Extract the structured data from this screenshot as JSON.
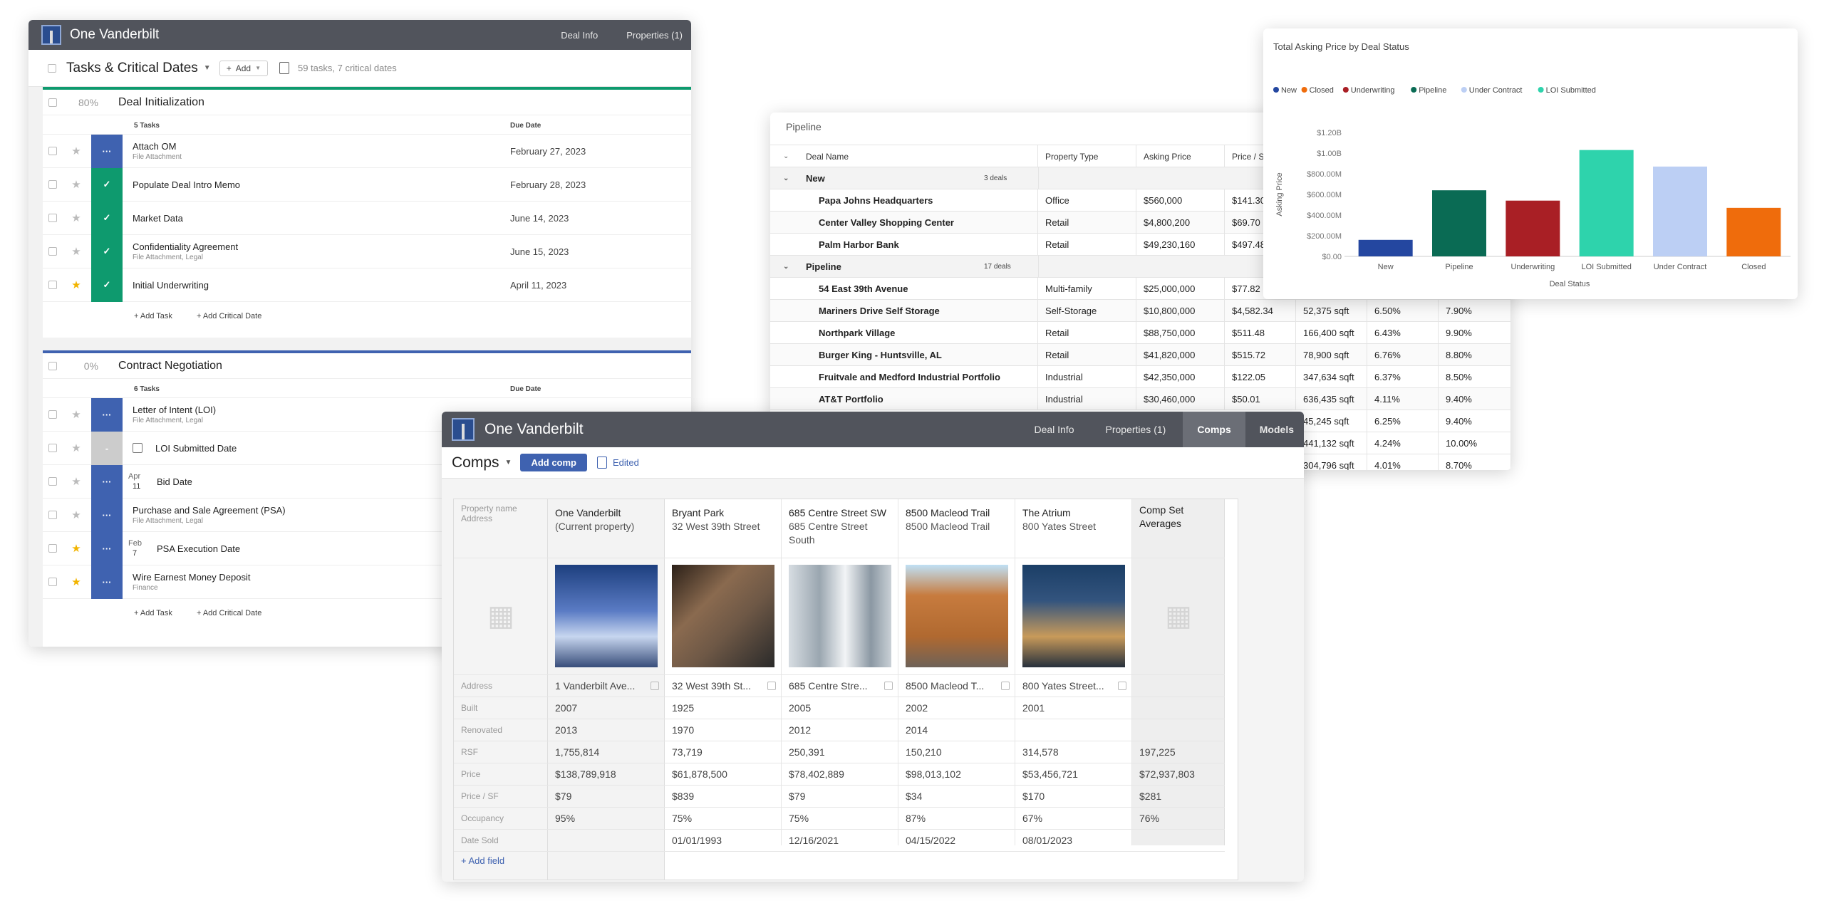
{
  "tasks_window": {
    "app_title": "One Vanderbilt",
    "nav": [
      "Deal Info",
      "Properties (1)"
    ],
    "title": "Tasks & Critical Dates",
    "add_label": "Add",
    "summary": "59 tasks, 7 critical dates",
    "due_header": "Due Date",
    "add_task": "Add Task",
    "add_critical": "Add Critical Date",
    "sections": [
      {
        "percent": "80%",
        "progress": 0.8,
        "name": "Deal Initialization",
        "count": "5 Tasks",
        "color": "#0e9a6e",
        "tasks": [
          {
            "name": "Attach OM",
            "sub": "File Attachment",
            "due": "February 27, 2023",
            "status": "blue",
            "star": false,
            "glyph": "···"
          },
          {
            "name": "Populate Deal Intro Memo",
            "sub": "",
            "due": "February 28, 2023",
            "status": "green",
            "star": false,
            "glyph": "✓"
          },
          {
            "name": "Market Data",
            "sub": "",
            "due": "June 14, 2023",
            "status": "green",
            "star": false,
            "glyph": "✓"
          },
          {
            "name": "Confidentiality Agreement",
            "sub": "File Attachment, Legal",
            "due": "June 15, 2023",
            "status": "green",
            "star": false,
            "glyph": "✓"
          },
          {
            "name": "Initial Underwriting",
            "sub": "",
            "due": "April 11, 2023",
            "status": "green",
            "star": true,
            "glyph": "✓"
          }
        ]
      },
      {
        "percent": "0%",
        "progress": 0,
        "name": "Contract Negotiation",
        "count": "6 Tasks",
        "color": "#3f62b0",
        "tasks": [
          {
            "name": "Letter of Intent (LOI)",
            "sub": "File Attachment, Legal",
            "status": "blue",
            "star": false,
            "glyph": "···"
          },
          {
            "name": "LOI Submitted Date",
            "sub": "",
            "status": "gray",
            "star": false,
            "glyph": "-",
            "date_icon": "calendar"
          },
          {
            "name": "Bid Date",
            "sub": "",
            "status": "blue",
            "star": false,
            "glyph": "···",
            "date_mon": "Apr",
            "date_day": "11"
          },
          {
            "name": "Purchase and Sale Agreement (PSA)",
            "sub": "File Attachment, Legal",
            "status": "blue",
            "star": false,
            "glyph": "···"
          },
          {
            "name": "PSA Execution Date",
            "sub": "",
            "status": "blue",
            "star": true,
            "glyph": "···",
            "date_mon": "Feb",
            "date_day": "7"
          },
          {
            "name": "Wire Earnest Money Deposit",
            "sub": "Finance",
            "status": "blue",
            "star": true,
            "glyph": "···"
          }
        ]
      }
    ]
  },
  "pipeline_window": {
    "title": "Pipeline",
    "headers": [
      "Deal Name",
      "Property Type",
      "Asking Price",
      "Price / S"
    ],
    "groups": [
      {
        "name": "New",
        "count": "3 deals",
        "rows": [
          {
            "name": "Papa Johns Headquarters",
            "type": "Office",
            "price": "$560,000",
            "psf": "$141.30"
          },
          {
            "name": "Center Valley Shopping Center",
            "type": "Retail",
            "price": "$4,800,200",
            "psf": "$69.70"
          },
          {
            "name": "Palm Harbor Bank",
            "type": "Retail",
            "price": "$49,230,160",
            "psf": "$497.48"
          }
        ]
      },
      {
        "name": "Pipeline",
        "count": "17 deals",
        "rows": [
          {
            "name": "54 East 39th Avenue",
            "type": "Multi-family",
            "price": "$25,000,000",
            "psf": "$77.82",
            "size": "",
            "cap": "",
            "occ": ""
          },
          {
            "name": "Mariners Drive Self Storage",
            "type": "Self-Storage",
            "price": "$10,800,000",
            "psf": "$4,582.34",
            "size": "52,375 sqft",
            "cap": "6.50%",
            "occ": "7.90%"
          },
          {
            "name": "Northpark Village",
            "type": "Retail",
            "price": "$88,750,000",
            "psf": "$511.48",
            "size": "166,400 sqft",
            "cap": "6.43%",
            "occ": "9.90%"
          },
          {
            "name": "Burger King - Huntsville, AL",
            "type": "Retail",
            "price": "$41,820,000",
            "psf": "$515.72",
            "size": "78,900 sqft",
            "cap": "6.76%",
            "occ": "8.80%"
          },
          {
            "name": "Fruitvale and Medford Industrial Portfolio",
            "type": "Industrial",
            "price": "$42,350,000",
            "psf": "$122.05",
            "size": "347,634 sqft",
            "cap": "6.37%",
            "occ": "8.50%"
          },
          {
            "name": "AT&T Portfolio",
            "type": "Industrial",
            "price": "$30,460,000",
            "psf": "$50.01",
            "size": "636,435 sqft",
            "cap": "4.11%",
            "occ": "9.40%"
          }
        ]
      }
    ],
    "extra_rows": [
      {
        "size": "45,245 sqft",
        "cap": "6.25%",
        "occ": "9.40%"
      },
      {
        "size": "441,132 sqft",
        "cap": "4.24%",
        "occ": "10.00%"
      },
      {
        "size": "304,796 sqft",
        "cap": "4.01%",
        "occ": "8.70%"
      }
    ]
  },
  "chart_window": {
    "chart_data": {
      "type": "bar",
      "title": "Total Asking Price by Deal Status",
      "xlabel": "Deal Status",
      "ylabel": "Asking Price",
      "legend": [
        "New",
        "Closed",
        "Underwriting",
        "Pipeline",
        "Under Contract",
        "LOI Submitted"
      ],
      "legend_colors": [
        "#2447a0",
        "#ef6c0c",
        "#a91f25",
        "#0a6b54",
        "#bccff4",
        "#2ed3ac"
      ],
      "categories": [
        "New",
        "Pipeline",
        "Underwriting",
        "LOI Submitted",
        "Under Contract",
        "Closed"
      ],
      "values": [
        160000000,
        640000000,
        540000000,
        1030000000,
        870000000,
        470000000
      ],
      "colors": [
        "#2447a0",
        "#0a6b54",
        "#a91f25",
        "#2ed3ac",
        "#bccff4",
        "#ef6c0c"
      ],
      "ylim": [
        0,
        1200000000
      ],
      "yticks": [
        "$0.00",
        "$200.00M",
        "$400.00M",
        "$600.00M",
        "$800.00M",
        "$1.00B",
        "$1.20B"
      ],
      "legend_position": "top-left",
      "grid": false
    }
  },
  "comps_window": {
    "app_title": "One Vanderbilt",
    "nav": [
      "Deal Info",
      "Properties (1)",
      "Comps",
      "Models"
    ],
    "active_nav": "Comps",
    "title": "Comps",
    "add_comp": "Add comp",
    "edited": "Edited",
    "corner_label_1": "Property name",
    "corner_label_2": "Address",
    "add_field": "+ Add field",
    "row_labels": [
      "Address",
      "Built",
      "Renovated",
      "RSF",
      "Price",
      "Price / SF",
      "Occupancy",
      "Date Sold"
    ],
    "columns": [
      {
        "name": "One Vanderbilt",
        "addr": "(Current property)",
        "addr2": "",
        "photo": "photo-skyscraper",
        "vals": [
          "1 Vanderbilt Ave...",
          "2007",
          "2013",
          "1,755,814",
          "$138,789,918",
          "$79",
          "95%",
          ""
        ]
      },
      {
        "name": "Bryant Park",
        "addr": "32 West 39th Street",
        "addr2": "",
        "photo": "photo-office-tower",
        "vals": [
          "32 West 39th St...",
          "1925",
          "1970",
          "73,719",
          "$61,878,500",
          "$839",
          "75%",
          "01/01/1993"
        ]
      },
      {
        "name": "685 Centre Street SW",
        "addr": "685 Centre Street",
        "addr2": "South",
        "photo": "photo-glass-tower",
        "vals": [
          "685 Centre Stre...",
          "2005",
          "2012",
          "250,391",
          "$78,402,889",
          "$79",
          "75%",
          "12/16/2021"
        ]
      },
      {
        "name": "8500 Macleod Trail",
        "addr": "8500 Macleod Trail",
        "addr2": "",
        "photo": "photo-brick-building",
        "vals": [
          "8500 Macleod T...",
          "2002",
          "2014",
          "150,210",
          "$98,013,102",
          "$34",
          "87%",
          "04/15/2022"
        ]
      },
      {
        "name": "The Atrium",
        "addr": "800 Yates Street",
        "addr2": "",
        "photo": "photo-modern-building",
        "vals": [
          "800 Yates Street...",
          "2001",
          "",
          "314,578",
          "$53,456,721",
          "$170",
          "67%",
          "08/01/2023"
        ]
      }
    ],
    "averages": {
      "name": "Comp Set",
      "name2": "Averages",
      "vals": [
        "",
        "",
        "",
        "197,225",
        "$72,937,803",
        "$281",
        "76%",
        ""
      ]
    }
  }
}
